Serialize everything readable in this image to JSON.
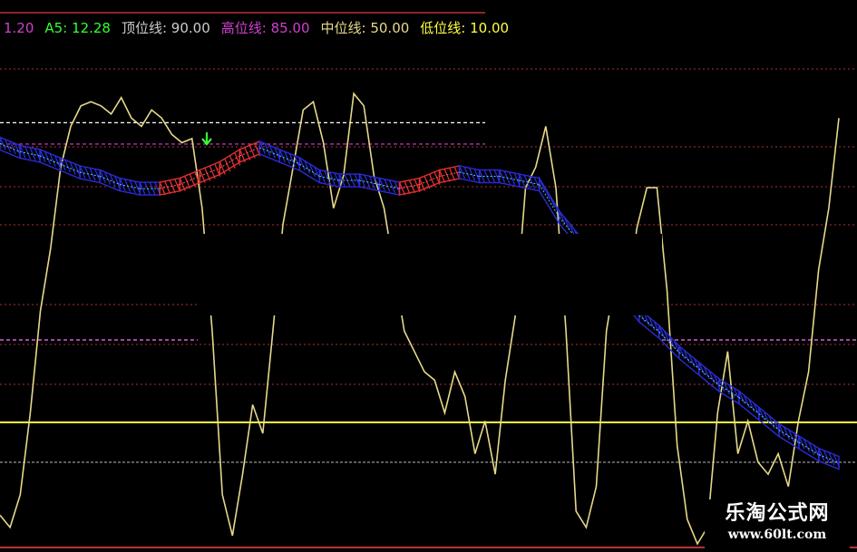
{
  "legend": {
    "a4": "1.20",
    "a5": "A5: 12.28",
    "top": "顶位线: 90.00",
    "high": "高位线: 85.00",
    "mid": "中位线: 50.00",
    "low": "低位线: 10.00"
  },
  "watermark": {
    "title": "乐淘公式网",
    "url": "www.60lt.com"
  },
  "colors": {
    "background": "#000000",
    "oscillator": "#e6d98a",
    "band_up": "#e03030",
    "band_down": "#2b2bd6",
    "band_line_up": "#ff5a5a",
    "band_line_down": "#4ad6d6",
    "top_line": "#ffffff",
    "high_line": "#d040d0",
    "mid_line": "#ff70ff",
    "low_line": "#ffff40",
    "guide_red": "#b03030",
    "signal_arrow": "#33ff33",
    "legend_a4": "#d040d0",
    "legend_a5": "#33ff33",
    "legend_label": "#cccccc",
    "legend_value_high": "#d040d0",
    "legend_value_mid": "#e6d98a",
    "legend_value_low": "#ffff40"
  },
  "chart_data": {
    "type": "line",
    "title": "",
    "xlabel": "",
    "ylabel": "",
    "ylim": [
      -12,
      112
    ],
    "levels": {
      "top": 90,
      "high": 85,
      "mid": 50,
      "low": 10
    },
    "series": [
      {
        "values": [
          -5,
          -8,
          0,
          20,
          45,
          60,
          80,
          90,
          95,
          96,
          95,
          93,
          97,
          92,
          90,
          94,
          92,
          88,
          86,
          87,
          70,
          40,
          0,
          -10,
          5,
          22,
          15,
          40,
          66,
          80,
          94,
          96,
          86,
          70,
          78,
          98,
          95,
          78,
          70,
          55,
          40,
          35,
          30,
          28,
          20,
          30,
          24,
          10,
          18,
          5,
          28,
          44,
          75,
          80,
          90,
          75,
          40,
          -4,
          -8,
          2,
          40,
          55,
          45,
          65,
          75,
          75,
          50,
          12,
          -6,
          -12,
          -8,
          20,
          35,
          10,
          18,
          8,
          5,
          10,
          2,
          18,
          30,
          55,
          70,
          92
        ],
        "signal": [
          88,
          86,
          85,
          83,
          81,
          80,
          78,
          77,
          77,
          78,
          80,
          82,
          85,
          87,
          85,
          83,
          80,
          79,
          79,
          78,
          77,
          78,
          80,
          81,
          80,
          80,
          79,
          78,
          70,
          64,
          57,
          52,
          46,
          42,
          37,
          33,
          29,
          26,
          22,
          18,
          15,
          12,
          10
        ]
      }
    ],
    "signal_start_index": 0
  }
}
